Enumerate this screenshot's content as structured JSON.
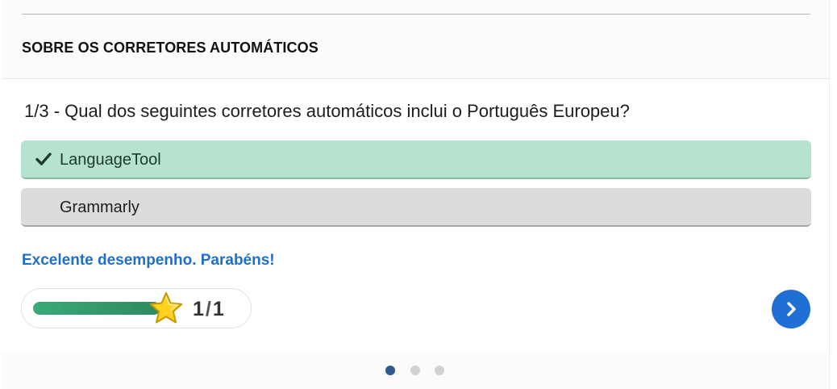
{
  "section": {
    "title": "SOBRE OS CORRETORES AUTOMÁTICOS"
  },
  "quiz": {
    "question": "1/3 - Qual dos seguintes corretores automáticos inclui o Português Europeu?",
    "answers": [
      {
        "label": "LanguageTool",
        "state": "correct",
        "icon": "check-icon"
      },
      {
        "label": "Grammarly",
        "state": "neutral"
      }
    ],
    "feedback": "Excelente desempenho. Parabéns!"
  },
  "score": {
    "current": "1",
    "separator": "/",
    "total": "1",
    "progress_fraction": 1.0,
    "icon": "star-icon"
  },
  "navigation": {
    "next_icon": "chevron-right-icon",
    "pages": 3,
    "active_page": 1
  },
  "colors": {
    "correct_bg": "#b5e3d0",
    "neutral_bg": "#dcdcdc",
    "feedback": "#1f6fca",
    "accent": "#1f6fd5",
    "progress": "#3aaa75",
    "dot_active": "#2d5a8c",
    "dot_inactive": "#d2d2d2"
  }
}
